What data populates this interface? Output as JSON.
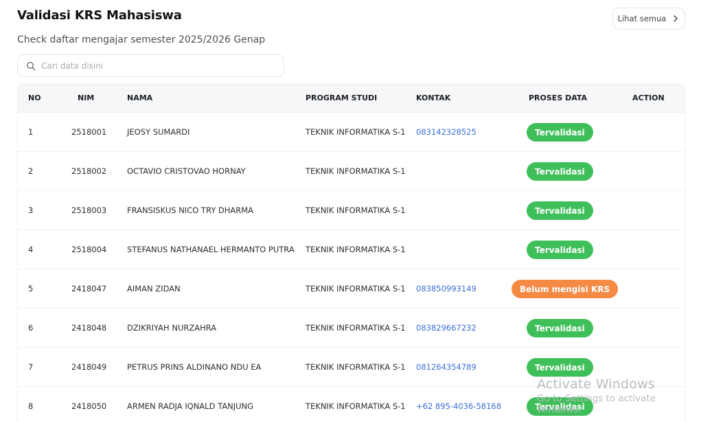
{
  "header": {
    "title": "Validasi KRS Mahasiswa",
    "subtitle": "Check daftar mengajar semester 2025/2026 Genap",
    "see_all_label": "Lihat semua"
  },
  "search": {
    "placeholder": "Cari data disini",
    "value": ""
  },
  "table": {
    "columns": {
      "no": "NO",
      "nim": "NIM",
      "nama": "NAMA",
      "program": "PROGRAM STUDI",
      "kontak": "KONTAK",
      "proses": "PROSES DATA",
      "action": "ACTION"
    },
    "rows": [
      {
        "no": "1",
        "nim": "2518001",
        "nama": "JEOSY SUMARDI",
        "program": "TEKNIK INFORMATIKA S-1",
        "kontak": "083142328525",
        "status": "Tervalidasi",
        "status_type": "ok"
      },
      {
        "no": "2",
        "nim": "2518002",
        "nama": "OCTAVIO CRISTOVAO HORNAY",
        "program": "TEKNIK INFORMATIKA S-1",
        "kontak": "",
        "status": "Tervalidasi",
        "status_type": "ok"
      },
      {
        "no": "3",
        "nim": "2518003",
        "nama": "FRANSISKUS NICO TRY DHARMA",
        "program": "TEKNIK INFORMATIKA S-1",
        "kontak": "",
        "status": "Tervalidasi",
        "status_type": "ok"
      },
      {
        "no": "4",
        "nim": "2518004",
        "nama": "STEFANUS NATHANAEL HERMANTO PUTRA",
        "program": "TEKNIK INFORMATIKA S-1",
        "kontak": "",
        "status": "Tervalidasi",
        "status_type": "ok"
      },
      {
        "no": "5",
        "nim": "2418047",
        "nama": "AIMAN ZIDAN",
        "program": "TEKNIK INFORMATIKA S-1",
        "kontak": "083850993149",
        "status": "Belum mengisi KRS",
        "status_type": "warn"
      },
      {
        "no": "6",
        "nim": "2418048",
        "nama": "DZIKRIYAH NURZAHRA",
        "program": "TEKNIK INFORMATIKA S-1",
        "kontak": "083829667232",
        "status": "Tervalidasi",
        "status_type": "ok"
      },
      {
        "no": "7",
        "nim": "2418049",
        "nama": "PETRUS PRINS ALDINANO NDU EA",
        "program": "TEKNIK INFORMATIKA S-1",
        "kontak": "081264354789",
        "status": "Tervalidasi",
        "status_type": "ok"
      },
      {
        "no": "8",
        "nim": "2418050",
        "nama": "ARMEN RADJA IQNALD TANJUNG",
        "program": "TEKNIK INFORMATIKA S-1",
        "kontak": "+62 895-4036-58168",
        "status": "Tervalidasi",
        "status_type": "ok"
      }
    ]
  },
  "watermark": {
    "line1": "Activate Windows",
    "line2": "Go to Settings to activate Windows."
  },
  "colors": {
    "ok": "#3fbf5a",
    "warn": "#f58a45",
    "link": "#3b6fd6"
  },
  "icons": {
    "search": "search-icon",
    "see_all": "chevron-right-icon"
  }
}
